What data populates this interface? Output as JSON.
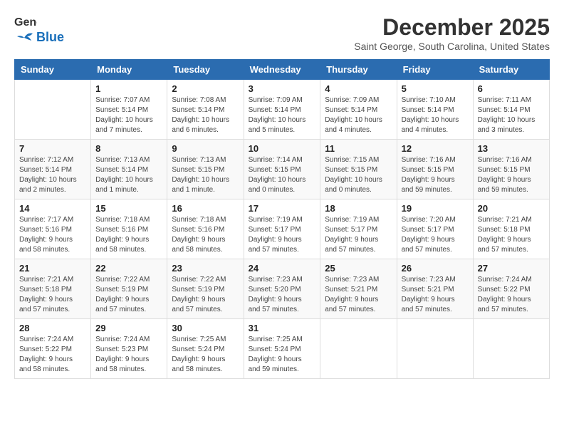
{
  "logo": {
    "line1": "General",
    "line2": "Blue"
  },
  "title": "December 2025",
  "subtitle": "Saint George, South Carolina, United States",
  "days_header": [
    "Sunday",
    "Monday",
    "Tuesday",
    "Wednesday",
    "Thursday",
    "Friday",
    "Saturday"
  ],
  "weeks": [
    [
      {
        "day": "",
        "details": ""
      },
      {
        "day": "1",
        "details": "Sunrise: 7:07 AM\nSunset: 5:14 PM\nDaylight: 10 hours\nand 7 minutes."
      },
      {
        "day": "2",
        "details": "Sunrise: 7:08 AM\nSunset: 5:14 PM\nDaylight: 10 hours\nand 6 minutes."
      },
      {
        "day": "3",
        "details": "Sunrise: 7:09 AM\nSunset: 5:14 PM\nDaylight: 10 hours\nand 5 minutes."
      },
      {
        "day": "4",
        "details": "Sunrise: 7:09 AM\nSunset: 5:14 PM\nDaylight: 10 hours\nand 4 minutes."
      },
      {
        "day": "5",
        "details": "Sunrise: 7:10 AM\nSunset: 5:14 PM\nDaylight: 10 hours\nand 4 minutes."
      },
      {
        "day": "6",
        "details": "Sunrise: 7:11 AM\nSunset: 5:14 PM\nDaylight: 10 hours\nand 3 minutes."
      }
    ],
    [
      {
        "day": "7",
        "details": "Sunrise: 7:12 AM\nSunset: 5:14 PM\nDaylight: 10 hours\nand 2 minutes."
      },
      {
        "day": "8",
        "details": "Sunrise: 7:13 AM\nSunset: 5:14 PM\nDaylight: 10 hours\nand 1 minute."
      },
      {
        "day": "9",
        "details": "Sunrise: 7:13 AM\nSunset: 5:15 PM\nDaylight: 10 hours\nand 1 minute."
      },
      {
        "day": "10",
        "details": "Sunrise: 7:14 AM\nSunset: 5:15 PM\nDaylight: 10 hours\nand 0 minutes."
      },
      {
        "day": "11",
        "details": "Sunrise: 7:15 AM\nSunset: 5:15 PM\nDaylight: 10 hours\nand 0 minutes."
      },
      {
        "day": "12",
        "details": "Sunrise: 7:16 AM\nSunset: 5:15 PM\nDaylight: 9 hours\nand 59 minutes."
      },
      {
        "day": "13",
        "details": "Sunrise: 7:16 AM\nSunset: 5:15 PM\nDaylight: 9 hours\nand 59 minutes."
      }
    ],
    [
      {
        "day": "14",
        "details": "Sunrise: 7:17 AM\nSunset: 5:16 PM\nDaylight: 9 hours\nand 58 minutes."
      },
      {
        "day": "15",
        "details": "Sunrise: 7:18 AM\nSunset: 5:16 PM\nDaylight: 9 hours\nand 58 minutes."
      },
      {
        "day": "16",
        "details": "Sunrise: 7:18 AM\nSunset: 5:16 PM\nDaylight: 9 hours\nand 58 minutes."
      },
      {
        "day": "17",
        "details": "Sunrise: 7:19 AM\nSunset: 5:17 PM\nDaylight: 9 hours\nand 57 minutes."
      },
      {
        "day": "18",
        "details": "Sunrise: 7:19 AM\nSunset: 5:17 PM\nDaylight: 9 hours\nand 57 minutes."
      },
      {
        "day": "19",
        "details": "Sunrise: 7:20 AM\nSunset: 5:17 PM\nDaylight: 9 hours\nand 57 minutes."
      },
      {
        "day": "20",
        "details": "Sunrise: 7:21 AM\nSunset: 5:18 PM\nDaylight: 9 hours\nand 57 minutes."
      }
    ],
    [
      {
        "day": "21",
        "details": "Sunrise: 7:21 AM\nSunset: 5:18 PM\nDaylight: 9 hours\nand 57 minutes."
      },
      {
        "day": "22",
        "details": "Sunrise: 7:22 AM\nSunset: 5:19 PM\nDaylight: 9 hours\nand 57 minutes."
      },
      {
        "day": "23",
        "details": "Sunrise: 7:22 AM\nSunset: 5:19 PM\nDaylight: 9 hours\nand 57 minutes."
      },
      {
        "day": "24",
        "details": "Sunrise: 7:23 AM\nSunset: 5:20 PM\nDaylight: 9 hours\nand 57 minutes."
      },
      {
        "day": "25",
        "details": "Sunrise: 7:23 AM\nSunset: 5:21 PM\nDaylight: 9 hours\nand 57 minutes."
      },
      {
        "day": "26",
        "details": "Sunrise: 7:23 AM\nSunset: 5:21 PM\nDaylight: 9 hours\nand 57 minutes."
      },
      {
        "day": "27",
        "details": "Sunrise: 7:24 AM\nSunset: 5:22 PM\nDaylight: 9 hours\nand 57 minutes."
      }
    ],
    [
      {
        "day": "28",
        "details": "Sunrise: 7:24 AM\nSunset: 5:22 PM\nDaylight: 9 hours\nand 58 minutes."
      },
      {
        "day": "29",
        "details": "Sunrise: 7:24 AM\nSunset: 5:23 PM\nDaylight: 9 hours\nand 58 minutes."
      },
      {
        "day": "30",
        "details": "Sunrise: 7:25 AM\nSunset: 5:24 PM\nDaylight: 9 hours\nand 58 minutes."
      },
      {
        "day": "31",
        "details": "Sunrise: 7:25 AM\nSunset: 5:24 PM\nDaylight: 9 hours\nand 59 minutes."
      },
      {
        "day": "",
        "details": ""
      },
      {
        "day": "",
        "details": ""
      },
      {
        "day": "",
        "details": ""
      }
    ]
  ]
}
